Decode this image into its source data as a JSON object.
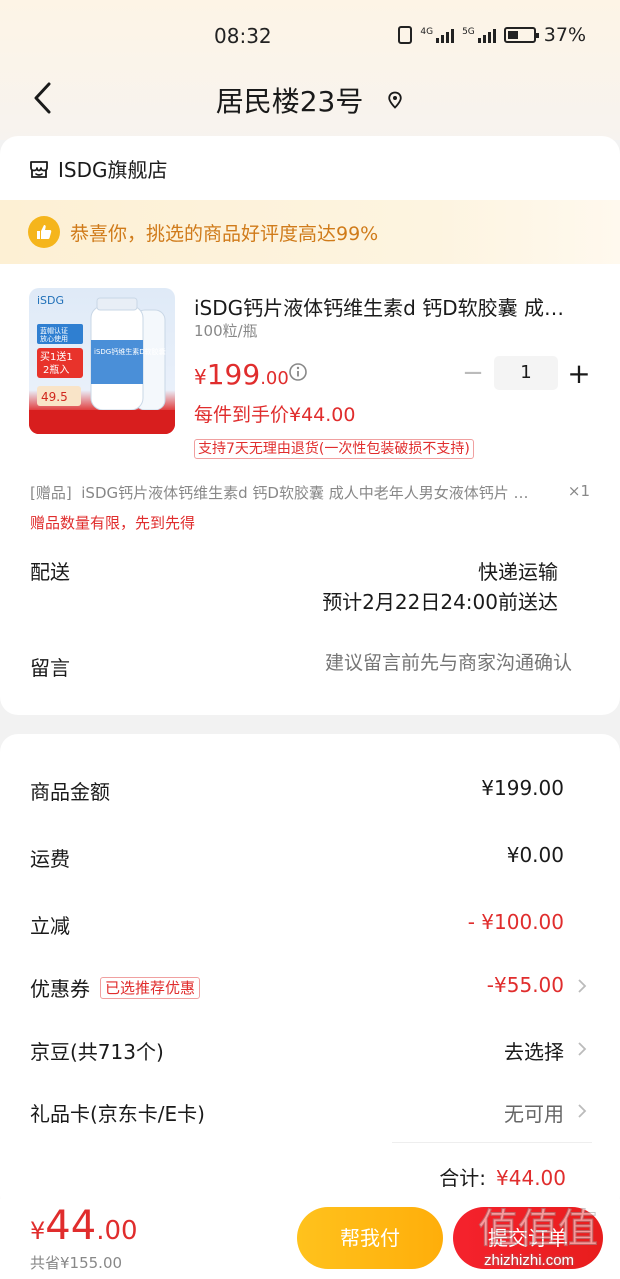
{
  "status_bar": {
    "time": "08:32",
    "net1": "4G",
    "net2": "5G",
    "battery": "37%"
  },
  "header": {
    "title": "居民楼23号"
  },
  "shop": {
    "name": "ISDG旗舰店"
  },
  "banner": {
    "text": "恭喜你，挑选的商品好评度高达99%"
  },
  "product": {
    "title": "iSDG钙片液体钙维生素d 钙D软胶囊 成…",
    "spec": "100粒/瓶",
    "price_currency": "¥",
    "price_int": "199",
    "price_dec": ".00",
    "quantity": "1",
    "unit_price_text": "每件到手价¥44.00",
    "return_policy": "支持7天无理由退货(一次性包装破损不支持)",
    "image_text": {
      "brand": "iSDG",
      "badge1": "蓝帽认证",
      "badge2": "放心使用",
      "promo_line1": "买1送1",
      "promo_line2": "2瓶入",
      "promo_price": "49.5",
      "bottle_label": "iSDG钙维生素D软胶囊"
    }
  },
  "gift": {
    "prefix": "[赠品]",
    "text": "iSDG钙片液体钙维生素d 钙D软胶囊 成人中老年人男女液体钙片 补…",
    "qty": "×1",
    "note": "赠品数量有限，先到先得"
  },
  "delivery": {
    "label": "配送",
    "method": "快递运输",
    "eta": "预计2月22日24:00前送达"
  },
  "message": {
    "label": "留言",
    "placeholder": "建议留言前先与商家沟通确认"
  },
  "summary": {
    "goods_label": "商品金额",
    "goods_value": "¥199.00",
    "shipping_label": "运费",
    "shipping_value": "¥0.00",
    "discount_label": "立减",
    "discount_value": "- ¥100.00",
    "coupon_label": "优惠券",
    "coupon_tag": "已选推荐优惠",
    "coupon_value": "-¥55.00",
    "jd_bean_label": "京豆(共713个)",
    "jd_bean_value": "去选择",
    "gift_card_label": "礼品卡(京东卡/E卡)",
    "gift_card_value": "无可用",
    "total_label": "合计:",
    "total_value": "¥44.00"
  },
  "footer": {
    "price_currency": "¥",
    "price_int": "44",
    "price_dec": ".00",
    "saved": "共省¥155.00",
    "help_pay": "帮我付",
    "submit": "提交订单"
  },
  "watermark": {
    "text": "zhizhizhi.com",
    "mark": "值值值"
  },
  "colors": {
    "accent_red": "#e02d2d",
    "help_yellow": "#ffb914",
    "banner_orange": "#d07b1a"
  }
}
